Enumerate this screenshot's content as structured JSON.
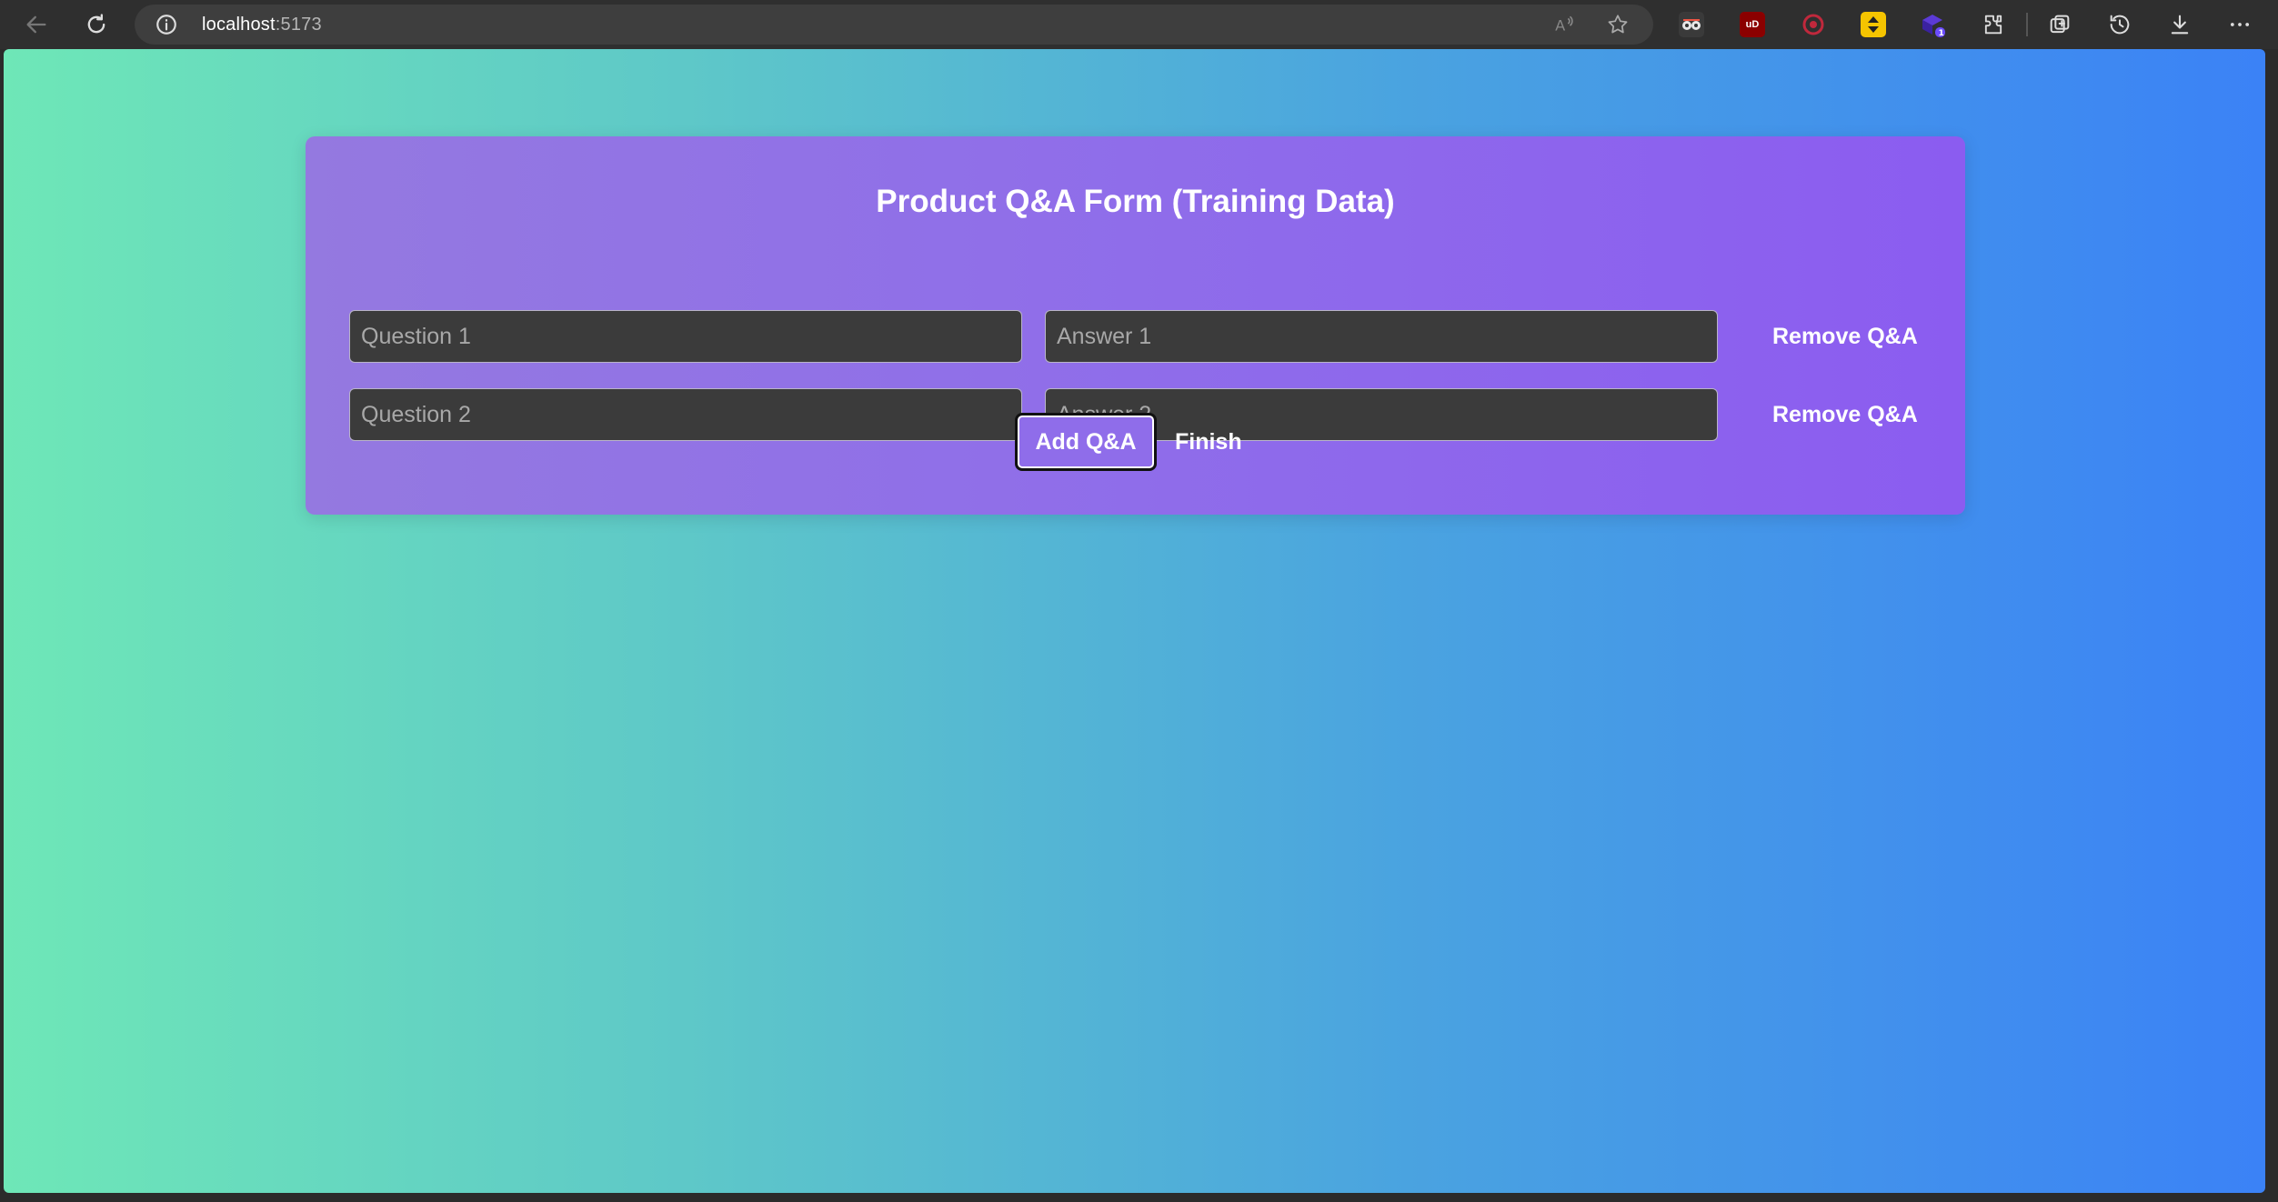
{
  "browser": {
    "url_host": "localhost",
    "url_port": ":5173",
    "extensions": [
      {
        "name": "glasses-extension-icon",
        "color": "#3a3a3a",
        "label": ""
      },
      {
        "name": "ublock-extension-icon",
        "color": "#8b0000",
        "label": "uD"
      },
      {
        "name": "red-circle-extension-icon",
        "color": "#3a3a3a",
        "label": ""
      },
      {
        "name": "yellow-arrows-extension-icon",
        "color": "#f5c400",
        "label": ""
      },
      {
        "name": "purple-cube-extension-icon",
        "color": "#4b2bbf",
        "label": "1"
      }
    ]
  },
  "form": {
    "title": "Product Q&A Form (Training Data)",
    "rows": [
      {
        "question_placeholder": "Question 1",
        "answer_placeholder": "Answer 1",
        "remove_label": "Remove Q&A"
      },
      {
        "question_placeholder": "Question 2",
        "answer_placeholder": "Answer 2",
        "remove_label": "Remove Q&A"
      }
    ],
    "add_label": "Add Q&A",
    "finish_label": "Finish"
  },
  "colors": {
    "page_gradient_start": "#6ee7b7",
    "page_gradient_end": "#3b82f6",
    "card_color": "#8f6dea",
    "input_background": "#3b3b3b"
  }
}
